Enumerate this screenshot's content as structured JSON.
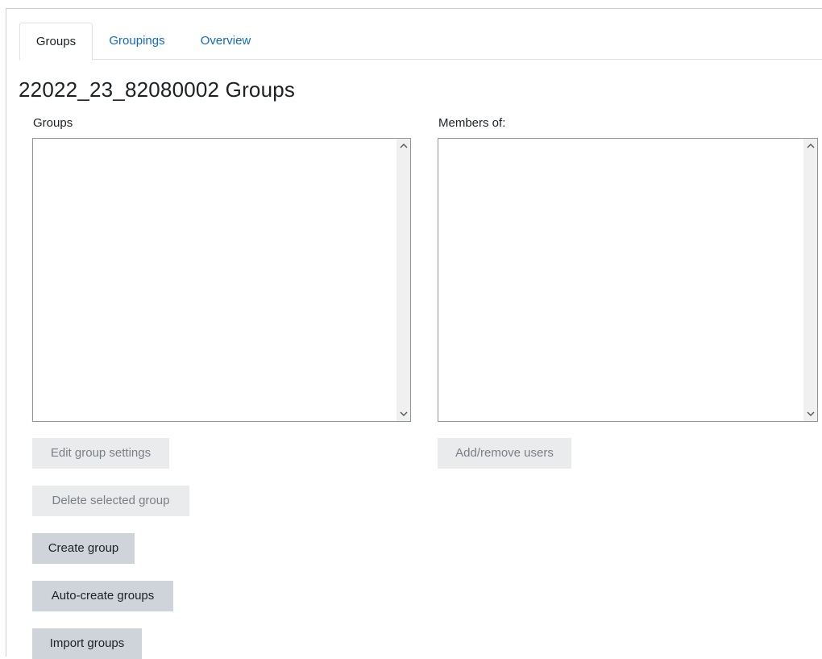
{
  "tabs": [
    {
      "label": "Groups",
      "active": true
    },
    {
      "label": "Groupings",
      "active": false
    },
    {
      "label": "Overview",
      "active": false
    }
  ],
  "page_title": "22022_23_82080002 Groups",
  "groups_panel": {
    "label": "Groups",
    "options": []
  },
  "members_panel": {
    "label": "Members of:",
    "options": []
  },
  "buttons": {
    "edit_group_settings": "Edit group settings",
    "delete_selected_group": "Delete selected group",
    "create_group": "Create group",
    "auto_create_groups": "Auto-create groups",
    "import_groups": "Import groups",
    "add_remove_users": "Add/remove users"
  },
  "icons": {
    "scroll_up": "chevron-up-icon",
    "scroll_down": "chevron-down-icon"
  },
  "colors": {
    "link": "#0f6cbf",
    "text": "#1d2125",
    "button_enabled_bg": "#ced4da",
    "button_disabled_bg": "#e9ebed"
  }
}
